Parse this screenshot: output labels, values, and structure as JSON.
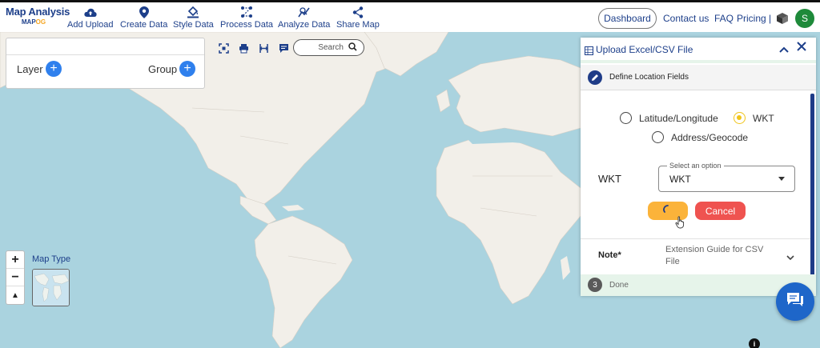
{
  "brand": {
    "title": "Map Analysis",
    "sub_a": "MAP",
    "sub_b": "OG"
  },
  "nav": [
    {
      "label": "Add Upload",
      "icon": "cloud-upload-icon"
    },
    {
      "label": "Create Data",
      "icon": "location-pin-icon"
    },
    {
      "label": "Style Data",
      "icon": "paint-bucket-icon"
    },
    {
      "label": "Process Data",
      "icon": "process-nodes-icon"
    },
    {
      "label": "Analyze Data",
      "icon": "analyze-chart-icon"
    },
    {
      "label": "Share Map",
      "icon": "share-icon"
    }
  ],
  "header_right": {
    "dashboard": "Dashboard",
    "contact": "Contact us",
    "faq": "FAQ",
    "pricing": "Pricing |",
    "avatar_initial": "S",
    "avatar_color": "#1e8a3a"
  },
  "layer_panel": {
    "layer_label": "Layer",
    "group_label": "Group",
    "add_symbol": "+"
  },
  "map_toolbar": {
    "search_placeholder": "Search"
  },
  "zoom": {
    "in": "+",
    "out": "−",
    "north": "▲"
  },
  "map_type": {
    "label": "Map Type"
  },
  "upload_panel": {
    "title": "Upload Excel/CSV File",
    "step2_label": "Define Location Fields",
    "radio_latlon": "Latitude/Longitude",
    "radio_wkt": "WKT",
    "radio_address": "Address/Geocode",
    "selected_radio": "WKT",
    "field_label": "WKT",
    "select_legend": "Select an option",
    "select_value": "WKT",
    "cancel_label": "Cancel",
    "note_label": "Note*",
    "note_text": "Extension Guide for CSV File",
    "step3_number": "3",
    "step3_label": "Done"
  },
  "info": "i",
  "colors": {
    "brand": "#1d3f8a",
    "accent_blue": "#2f80ed",
    "ocean": "#aad3df",
    "land": "#f2efe9",
    "load_button": "#fbb33a",
    "cancel_button": "#ef5350",
    "chat_button": "#1e66c9"
  }
}
